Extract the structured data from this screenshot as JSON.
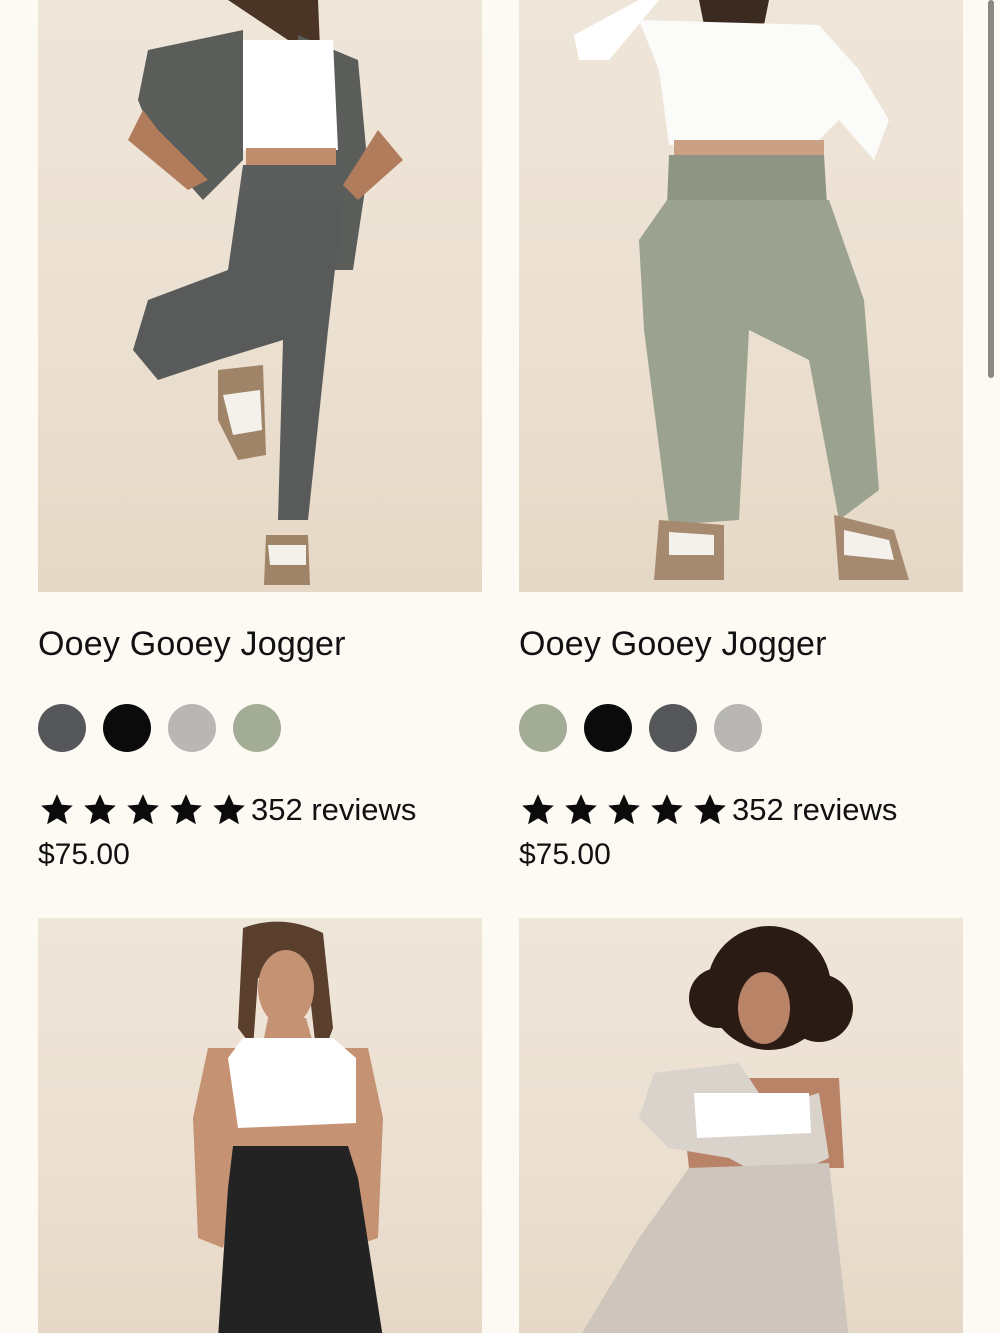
{
  "products": [
    {
      "name": "Ooey Gooey Jogger",
      "swatches": [
        {
          "color": "#55575a",
          "label": "charcoal"
        },
        {
          "color": "#0b0b0b",
          "label": "black"
        },
        {
          "color": "#b8b7b3",
          "label": "light grey"
        },
        {
          "color": "#a3ac94",
          "label": "sage"
        }
      ],
      "rating": 5,
      "reviews": "352 reviews",
      "price": "$75.00",
      "image_icon": "model-photo-charcoal-jogger"
    },
    {
      "name": "Ooey Gooey Jogger",
      "swatches": [
        {
          "color": "#a3ac94",
          "label": "sage"
        },
        {
          "color": "#0b0b0b",
          "label": "black"
        },
        {
          "color": "#55575a",
          "label": "charcoal"
        },
        {
          "color": "#b8b7b3",
          "label": "light grey"
        }
      ],
      "rating": 5,
      "reviews": "352 reviews",
      "price": "$75.00",
      "image_icon": "model-photo-sage-jogger"
    },
    {
      "image_icon": "model-photo-black-jogger"
    },
    {
      "image_icon": "model-photo-oatmeal-jogger"
    }
  ],
  "colors": {
    "background": "#fdfaf4",
    "photo_bg": "#ebdfd0",
    "star": "#0b0b0b"
  }
}
